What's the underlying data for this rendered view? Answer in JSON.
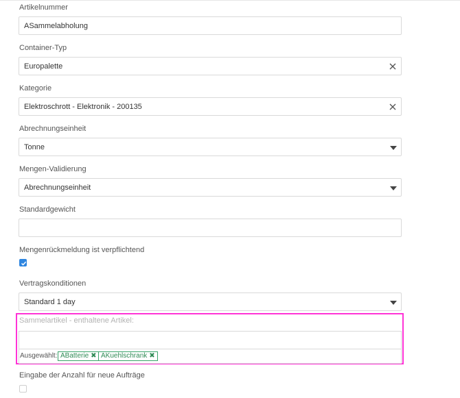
{
  "form": {
    "artikelnummer": {
      "label": "Artikelnummer",
      "value": "ASammelabholung"
    },
    "container_typ": {
      "label": "Container-Typ",
      "value": "Europalette"
    },
    "kategorie": {
      "label": "Kategorie",
      "value": "Elektroschrott - Elektronik  - 200135"
    },
    "abrechnungseinheit": {
      "label": "Abrechnungseinheit",
      "value": "Tonne"
    },
    "mengen_validierung": {
      "label": "Mengen-Validierung",
      "value": "Abrechnungseinheit"
    },
    "standardgewicht": {
      "label": "Standardgewicht",
      "value": ""
    },
    "mengenrueckmeldung": {
      "label": "Mengenrückmeldung ist verpflichtend",
      "checked": true
    },
    "vertragskonditionen": {
      "label": "Vertragskonditionen",
      "value": "Standard 1 day"
    },
    "sammelartikel": {
      "label": "Sammelartikel - enthaltene Artikel:",
      "input_value": "",
      "selected_label": "Ausgewählt:",
      "selected": [
        "ABatterie",
        "AKuehlschrank"
      ],
      "remove_glyph": "✖"
    },
    "eingabe_anzahl": {
      "label": "Eingabe der Anzahl für neue Aufträge",
      "checked": false
    }
  },
  "colors": {
    "highlight": "#ff33d6",
    "tag_green": "#3aa36a",
    "checkbox_blue": "#2f86e0"
  },
  "icons": {
    "clear": "close-icon",
    "dropdown": "caret-down-icon",
    "check": "checkmark-icon"
  }
}
